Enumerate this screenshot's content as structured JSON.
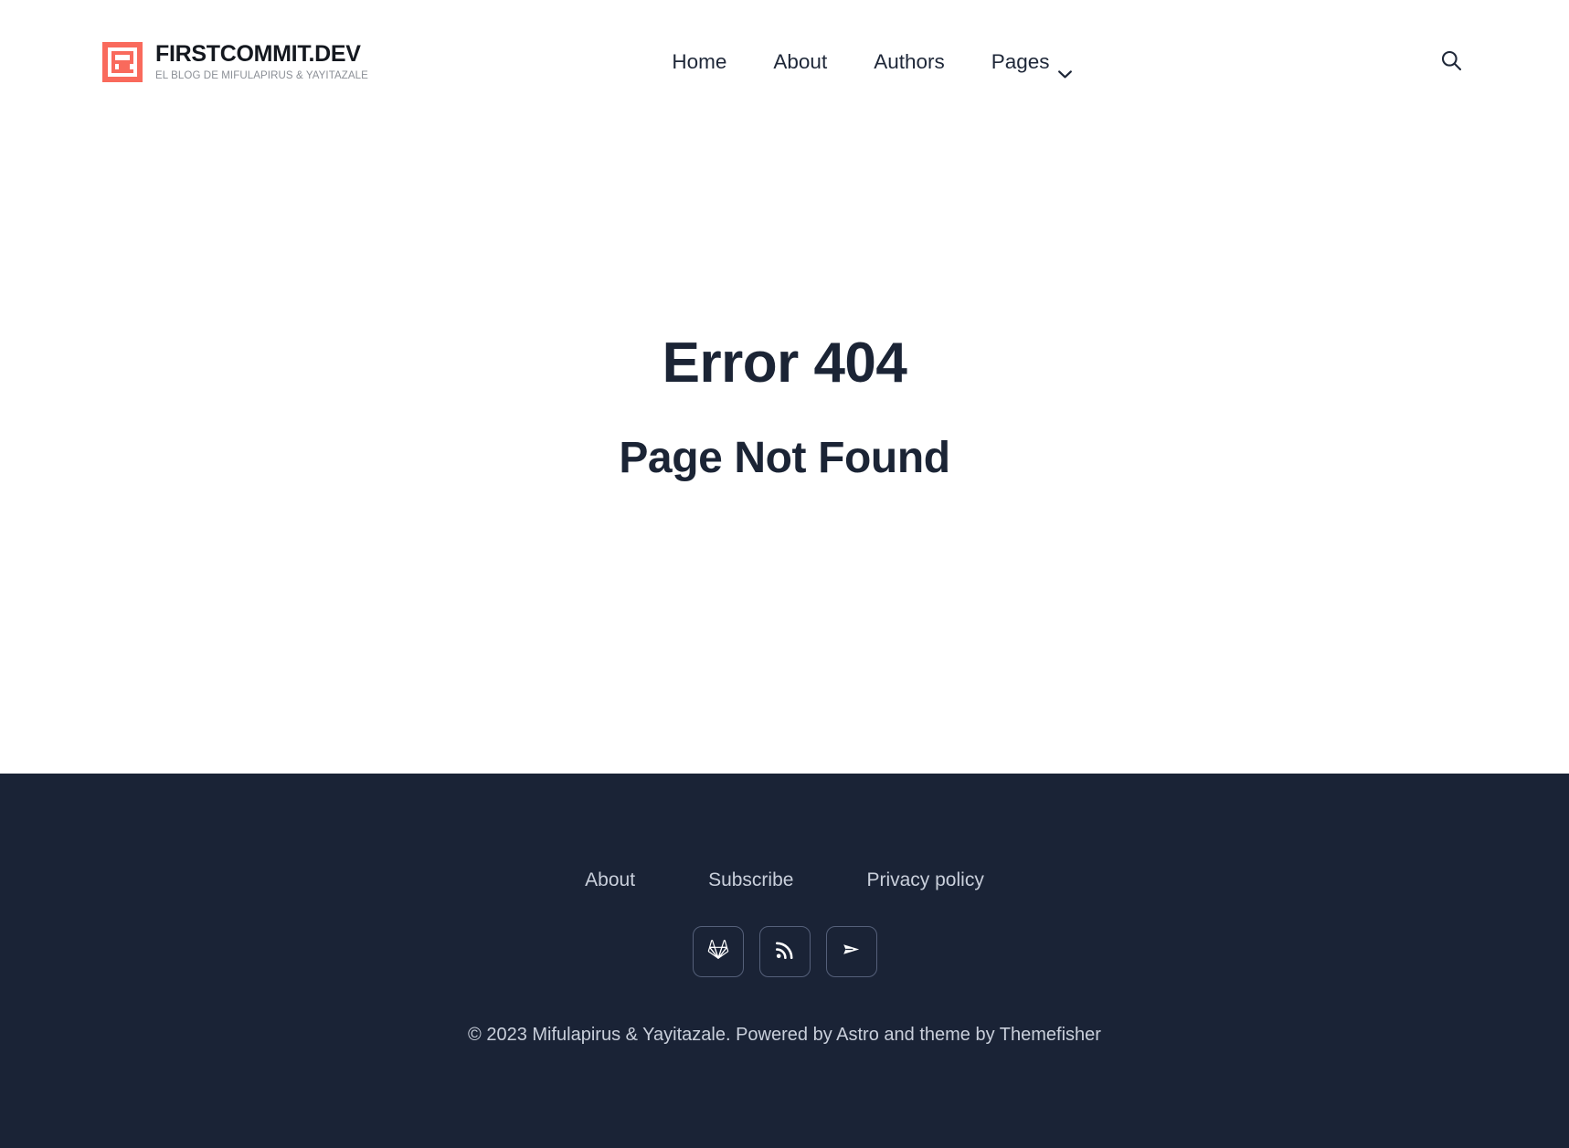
{
  "brand": {
    "name": "FIRSTCOMMIT.DEV",
    "tagline": "EL BLOG DE MIFULAPIRUS & YAYITAZALE",
    "mark_color": "#f96a5c"
  },
  "header": {
    "nav": [
      {
        "label": "Home",
        "has_dropdown": false
      },
      {
        "label": "About",
        "has_dropdown": false
      },
      {
        "label": "Authors",
        "has_dropdown": false
      },
      {
        "label": "Pages",
        "has_dropdown": true
      }
    ],
    "search_icon": "search-icon"
  },
  "main": {
    "error_code": "Error 404",
    "error_message": "Page Not Found"
  },
  "footer": {
    "background_color": "#1a2336",
    "text_color": "#c9cfdb",
    "links": [
      {
        "label": "About"
      },
      {
        "label": "Subscribe"
      },
      {
        "label": "Privacy policy"
      }
    ],
    "social": [
      {
        "name": "gitlab-icon",
        "label": "GitLab"
      },
      {
        "name": "rss-icon",
        "label": "RSS"
      },
      {
        "name": "telegram-icon",
        "label": "Telegram"
      }
    ],
    "copyright": "© 2023 Mifulapirus & Yayitazale. Powered by Astro and theme by Themefisher"
  }
}
